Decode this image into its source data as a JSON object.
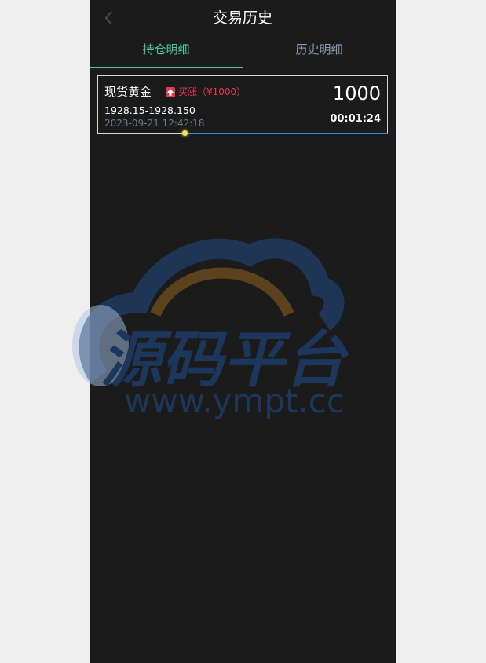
{
  "header": {
    "title": "交易历史"
  },
  "tabs": [
    {
      "label": "持仓明细",
      "active": true
    },
    {
      "label": "历史明细",
      "active": false
    }
  ],
  "position": {
    "product": "现货黄金",
    "direction_icon": "up-arrow-icon",
    "direction_label": "买涨（¥1000）",
    "amount": "1000",
    "price_range": "1928.15-1928.150",
    "open_time": "2023-09-21 12:42:18",
    "countdown": "00:01:24",
    "progress": 0.7
  },
  "watermark": {
    "title": "源码平台",
    "url": "www.ympt.cc"
  },
  "colors": {
    "accent": "#4ec6a0",
    "up": "#e8394a",
    "progress": "#2e8fd8"
  }
}
